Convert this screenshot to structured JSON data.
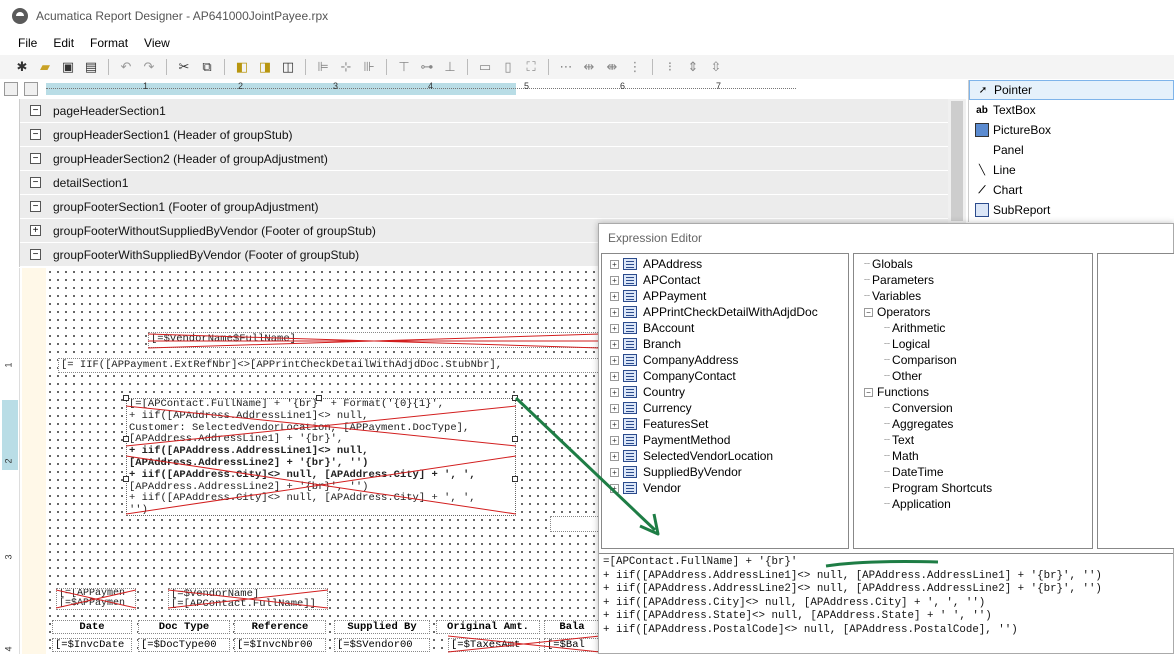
{
  "window": {
    "title": "Acumatica Report Designer - AP641000JointPayee.rpx"
  },
  "menu": [
    "File",
    "Edit",
    "Format",
    "View"
  ],
  "toolbar": {
    "buttons": [
      "new-icon",
      "open-icon",
      "save-icon",
      "save-as-icon",
      "undo-icon",
      "redo-icon",
      "cut-icon",
      "copy-icon",
      "align-group-icon",
      "align-group-2-icon",
      "align-group-3-icon",
      "align-left-icon",
      "align-center-icon",
      "align-right-icon",
      "align-top-icon",
      "align-middle-icon",
      "align-bottom-icon",
      "size-width-icon",
      "size-height-icon",
      "size-both-icon",
      "hspace-equal-icon",
      "hspace-increase-icon",
      "hspace-decrease-icon",
      "hspace-remove-icon",
      "vspace-equal-icon",
      "vspace-increase-icon",
      "vspace-decrease-icon"
    ]
  },
  "ruler": {
    "numbers": [
      "1",
      "2",
      "3",
      "4",
      "5",
      "6",
      "7"
    ]
  },
  "sections": [
    {
      "label": "pageHeaderSection1",
      "toggle": "−"
    },
    {
      "label": "groupHeaderSection1 (Header of groupStub)",
      "toggle": "−"
    },
    {
      "label": "groupHeaderSection2 (Header of groupAdjustment)",
      "toggle": "−"
    },
    {
      "label": "detailSection1",
      "toggle": "−"
    },
    {
      "label": "groupFooterSection1 (Footer of groupAdjustment)",
      "toggle": "−"
    },
    {
      "label": "groupFooterWithoutSuppliedByVendor (Footer of groupStub)",
      "toggle": "+"
    },
    {
      "label": "groupFooterWithSuppliedByVendor (Footer of groupStub)",
      "toggle": "−"
    }
  ],
  "vruler": {
    "numbers": [
      "1",
      "2",
      "3",
      "4"
    ]
  },
  "canvas": {
    "fields": {
      "vendor_fullname": "[=$VendorName$FullName]",
      "iif_extref": "[= IIF([APPayment.ExtRefNbr]<>[APPrintCheckDetailWithAdjdDoc.StubNbr],",
      "block1_l1": "[=[APContact.FullName] + '{br}' + Format('{0}{1}',",
      "block1_l2": "+ iif([APAddress.AddressLine1]<> null,",
      "block1_l3": "Customer: SelectedVendorLocation, [APPayment.DocType],",
      "block1_l4": "[APAddress.AddressLine1] + '{br}',",
      "block1_l5": "+ iif([APAddress.AddressLine1]<> null,",
      "block1_l6": "[APAddress.AddressLine2] + '{br}', '')",
      "block1_l7": "+ iif([APAddress.City]<> null, [APAddress.City] + ', ',",
      "block1_l8": "[APAddress.AddressLine2] + '{br}', '')",
      "block1_l9": "+ iif([APAddress.City]<> null, [APAddress.City] + ', ',",
      "block1_l10": "'')",
      "payment_a": "[=[APPaymen",
      "payment_b": "[=$APPaymen",
      "vendorname": "[=$VendorName]",
      "contactname": "[=[APContact.FullName]]"
    },
    "column_headers": [
      "Date",
      "Doc Type",
      "Reference",
      "Supplied By",
      "Original Amt.",
      "Bala"
    ],
    "column_cells": [
      "[=$InvcDate",
      "[=$DocType00",
      "[=$InvcNbr00",
      "[=$SVendor00",
      "[=$TaxesAmt",
      "[=$Bal"
    ]
  },
  "toolbox": {
    "items": [
      {
        "label": "Pointer",
        "icon": "pointer-icon"
      },
      {
        "label": "TextBox",
        "icon": "textbox-icon",
        "glyph": "ab"
      },
      {
        "label": "PictureBox",
        "icon": "picturebox-icon"
      },
      {
        "label": "Panel",
        "icon": "panel-icon"
      },
      {
        "label": "Line",
        "icon": "line-icon"
      },
      {
        "label": "Chart",
        "icon": "chart-icon"
      },
      {
        "label": "SubReport",
        "icon": "subreport-icon"
      }
    ]
  },
  "expression_editor": {
    "title": "Expression Editor",
    "tables": [
      "APAddress",
      "APContact",
      "APPayment",
      "APPrintCheckDetailWithAdjdDoc",
      "BAccount",
      "Branch",
      "CompanyAddress",
      "CompanyContact",
      "Country",
      "Currency",
      "FeaturesSet",
      "PaymentMethod",
      "SelectedVendorLocation",
      "SuppliedByVendor",
      "Vendor"
    ],
    "categories": [
      {
        "label": "Globals",
        "level": 0,
        "toggle": ""
      },
      {
        "label": "Parameters",
        "level": 0,
        "toggle": ""
      },
      {
        "label": "Variables",
        "level": 0,
        "toggle": ""
      },
      {
        "label": "Operators",
        "level": 0,
        "toggle": "−"
      },
      {
        "label": "Arithmetic",
        "level": 1,
        "toggle": ""
      },
      {
        "label": "Logical",
        "level": 1,
        "toggle": ""
      },
      {
        "label": "Comparison",
        "level": 1,
        "toggle": ""
      },
      {
        "label": "Other",
        "level": 1,
        "toggle": ""
      },
      {
        "label": "Functions",
        "level": 0,
        "toggle": "−"
      },
      {
        "label": "Conversion",
        "level": 1,
        "toggle": ""
      },
      {
        "label": "Aggregates",
        "level": 1,
        "toggle": ""
      },
      {
        "label": "Text",
        "level": 1,
        "toggle": ""
      },
      {
        "label": "Math",
        "level": 1,
        "toggle": ""
      },
      {
        "label": "DateTime",
        "level": 1,
        "toggle": ""
      },
      {
        "label": "Program Shortcuts",
        "level": 1,
        "toggle": ""
      },
      {
        "label": "Application",
        "level": 1,
        "toggle": ""
      }
    ],
    "expression_lines": [
      "=[APContact.FullName] + '{br}'",
      "+ iif([APAddress.AddressLine1]<> null, [APAddress.AddressLine1] + '{br}', '')",
      "+ iif([APAddress.AddressLine2]<> null, [APAddress.AddressLine2] + '{br}', '')",
      "+ iif([APAddress.City]<> null, [APAddress.City] + ', ', '')",
      "+ iif([APAddress.State]<> null, [APAddress.State] + ' ', '')",
      "+ iif([APAddress.PostalCode]<> null, [APAddress.PostalCode], '')"
    ]
  },
  "colors": {
    "annotation_green": "#1e7d45",
    "strike_red": "#d21e1e",
    "ruler_highlight": "#b9dde6",
    "section_bg": "#ececec"
  }
}
